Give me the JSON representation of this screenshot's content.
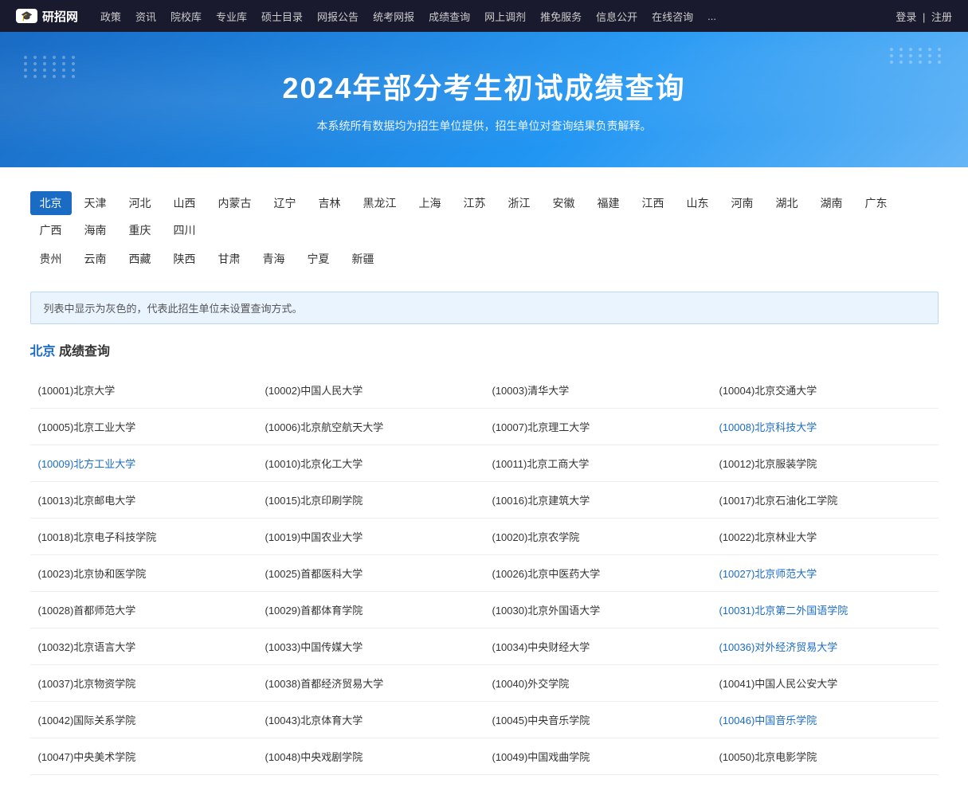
{
  "nav": {
    "logo_text": "研招网",
    "logo_icon": "🎓",
    "items": [
      "政策",
      "资讯",
      "院校库",
      "专业库",
      "硕士目录",
      "网报公告",
      "统考网报",
      "成绩查询",
      "网上调剂",
      "推免服务",
      "信息公开",
      "在线咨询",
      "..."
    ],
    "login": "登录",
    "separator": "|",
    "register": "注册"
  },
  "hero": {
    "title": "2024年部分考生初试成绩查询",
    "subtitle": "本系统所有数据均为招生单位提供，招生单位对查询结果负责解释。"
  },
  "regions_row1": [
    "北京",
    "天津",
    "河北",
    "山西",
    "内蒙古",
    "辽宁",
    "吉林",
    "黑龙江",
    "上海",
    "江苏",
    "浙江",
    "安徽",
    "福建",
    "江西",
    "山东",
    "河南",
    "湖北",
    "湖南",
    "广东",
    "广西",
    "海南",
    "重庆",
    "四川"
  ],
  "regions_row2": [
    "贵州",
    "云南",
    "西藏",
    "陕西",
    "甘肃",
    "青海",
    "宁夏",
    "新疆"
  ],
  "active_region": "北京",
  "notice": "列表中显示为灰色的，代表此招生单位未设置查询方式。",
  "section": {
    "region": "北京",
    "label": " 成绩查询"
  },
  "universities": [
    [
      {
        "code": "10001",
        "name": "北京大学",
        "link": false
      },
      {
        "code": "10002",
        "name": "中国人民大学",
        "link": false
      },
      {
        "code": "10003",
        "name": "清华大学",
        "link": false
      },
      {
        "code": "10004",
        "name": "北京交通大学",
        "link": false
      }
    ],
    [
      {
        "code": "10005",
        "name": "北京工业大学",
        "link": false
      },
      {
        "code": "10006",
        "name": "北京航空航天大学",
        "link": false
      },
      {
        "code": "10007",
        "name": "北京理工大学",
        "link": false
      },
      {
        "code": "10008",
        "name": "北京科技大学",
        "link": true
      }
    ],
    [
      {
        "code": "10009",
        "name": "北方工业大学",
        "link": true
      },
      {
        "code": "10010",
        "name": "北京化工大学",
        "link": false
      },
      {
        "code": "10011",
        "name": "北京工商大学",
        "link": false
      },
      {
        "code": "10012",
        "name": "北京服装学院",
        "link": false
      }
    ],
    [
      {
        "code": "10013",
        "name": "北京邮电大学",
        "link": false
      },
      {
        "code": "10015",
        "name": "北京印刷学院",
        "link": false
      },
      {
        "code": "10016",
        "name": "北京建筑大学",
        "link": false
      },
      {
        "code": "10017",
        "name": "北京石油化工学院",
        "link": false
      }
    ],
    [
      {
        "code": "10018",
        "name": "北京电子科技学院",
        "link": false
      },
      {
        "code": "10019",
        "name": "中国农业大学",
        "link": false
      },
      {
        "code": "10020",
        "name": "北京农学院",
        "link": false
      },
      {
        "code": "10022",
        "name": "北京林业大学",
        "link": false
      }
    ],
    [
      {
        "code": "10023",
        "name": "北京协和医学院",
        "link": false
      },
      {
        "code": "10025",
        "name": "首都医科大学",
        "link": false
      },
      {
        "code": "10026",
        "name": "北京中医药大学",
        "link": false
      },
      {
        "code": "10027",
        "name": "北京师范大学",
        "link": true
      }
    ],
    [
      {
        "code": "10028",
        "name": "首都师范大学",
        "link": false
      },
      {
        "code": "10029",
        "name": "首都体育学院",
        "link": false
      },
      {
        "code": "10030",
        "name": "北京外国语大学",
        "link": false
      },
      {
        "code": "10031",
        "name": "北京第二外国语学院",
        "link": true
      }
    ],
    [
      {
        "code": "10032",
        "name": "北京语言大学",
        "link": false
      },
      {
        "code": "10033",
        "name": "中国传媒大学",
        "link": false
      },
      {
        "code": "10034",
        "name": "中央财经大学",
        "link": false
      },
      {
        "code": "10036",
        "name": "对外经济贸易大学",
        "link": true
      }
    ],
    [
      {
        "code": "10037",
        "name": "北京物资学院",
        "link": false
      },
      {
        "code": "10038",
        "name": "首都经济贸易大学",
        "link": false
      },
      {
        "code": "10040",
        "name": "外交学院",
        "link": false
      },
      {
        "code": "10041",
        "name": "中国人民公安大学",
        "link": false
      }
    ],
    [
      {
        "code": "10042",
        "name": "国际关系学院",
        "link": false
      },
      {
        "code": "10043",
        "name": "北京体育大学",
        "link": false
      },
      {
        "code": "10045",
        "name": "中央音乐学院",
        "link": false
      },
      {
        "code": "10046",
        "name": "中国音乐学院",
        "link": true
      }
    ],
    [
      {
        "code": "10047",
        "name": "中央美术学院",
        "link": false
      },
      {
        "code": "10048",
        "name": "中央戏剧学院",
        "link": false
      },
      {
        "code": "10049",
        "name": "中国戏曲学院",
        "link": false
      },
      {
        "code": "10050",
        "name": "北京电影学院",
        "link": false
      }
    ]
  ]
}
